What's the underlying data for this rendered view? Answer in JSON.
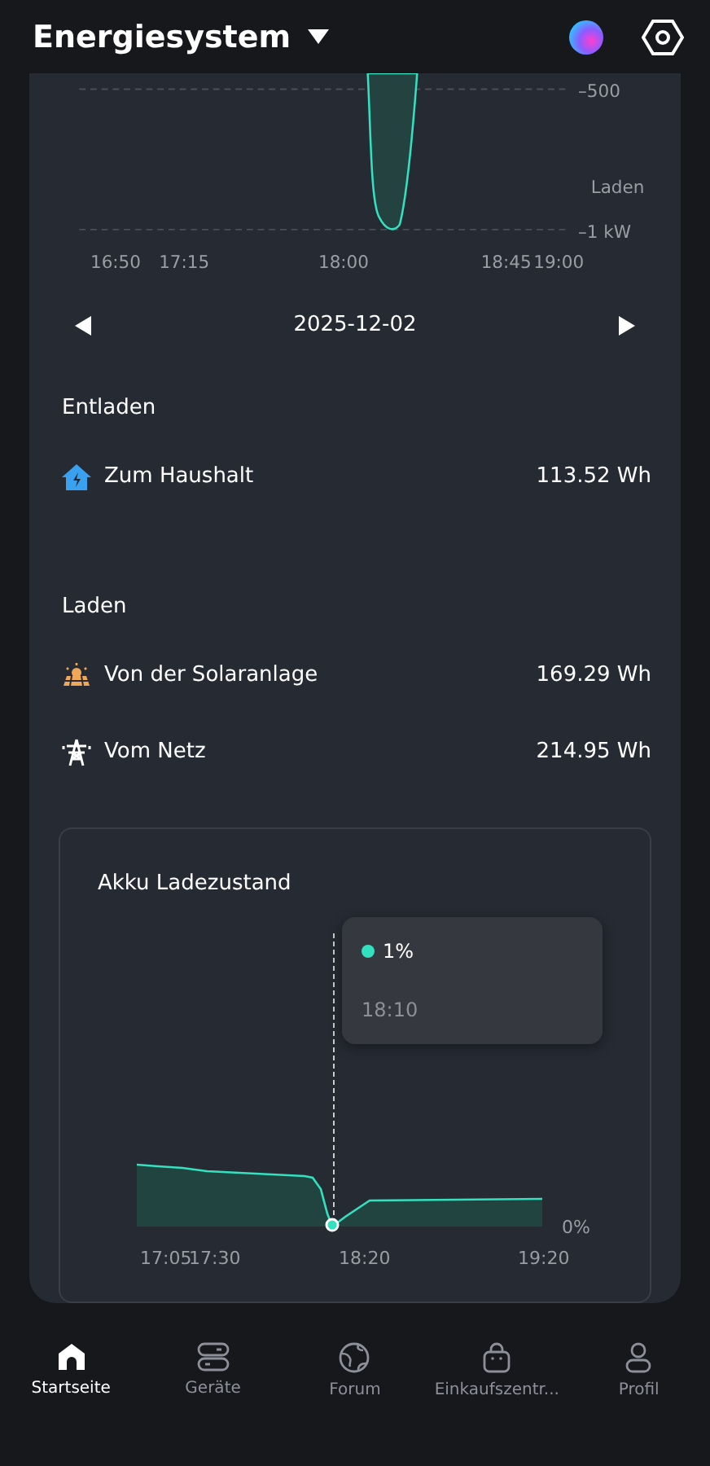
{
  "header": {
    "title": "Energiesystem"
  },
  "power_chart": {
    "y_labels": [
      "–500",
      "–1 kW"
    ],
    "caption": "Laden",
    "x_labels": [
      "16:50",
      "17:15",
      "18:00",
      "18:45",
      "19:00"
    ]
  },
  "date_nav": {
    "date": "2025-12-02"
  },
  "sections": [
    {
      "title": "Entladen",
      "rows": [
        {
          "kind": "house",
          "label": "Zum Haushalt",
          "value": "113.52 Wh"
        }
      ]
    },
    {
      "title": "Laden",
      "rows": [
        {
          "kind": "solar",
          "label": "Von der Solaranlage",
          "value": "169.29 Wh"
        },
        {
          "kind": "grid",
          "label": "Vom Netz",
          "value": "214.95 Wh"
        }
      ]
    }
  ],
  "soc_card": {
    "title": "Akku Ladezustand",
    "y_label": "0%",
    "x_labels": [
      "17:05",
      "17:30",
      "18:20",
      "19:20"
    ],
    "tooltip": {
      "value": "1%",
      "time": "18:10"
    }
  },
  "nav": [
    {
      "kind": "home",
      "label": "Startseite",
      "selected": true
    },
    {
      "kind": "devices",
      "label": "Geräte",
      "selected": false
    },
    {
      "kind": "globe",
      "label": "Forum",
      "selected": false
    },
    {
      "kind": "bag",
      "label": "Einkaufszentr...",
      "selected": false
    },
    {
      "kind": "person",
      "label": "Profil",
      "selected": false
    }
  ]
}
